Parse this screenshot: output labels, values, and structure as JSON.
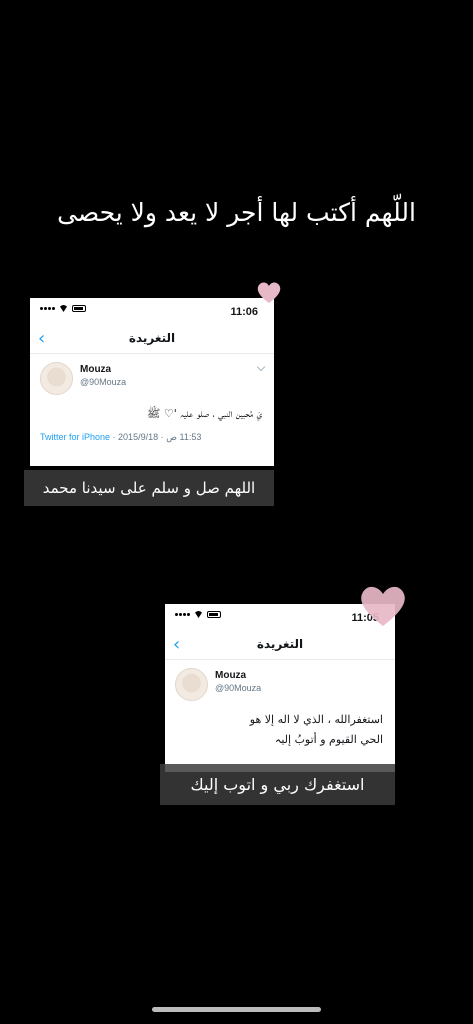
{
  "title": "اللّهم أكتب لها أجر لا يعد ولا يحصى",
  "tweets": [
    {
      "time": "11:06",
      "nav_title": "التغريدة",
      "back_icon": "chevron-left-icon",
      "name": "Mouza",
      "handle": "@90Mouza",
      "text": "يَ مُحبين النبي ، صلو عليہ '♡ ﷺ",
      "source": "Twitter for iPhone",
      "date": "2015/9/18",
      "clock": "11:53 ص",
      "caption": "اللهم صل و سلم على سيدنا محمد"
    },
    {
      "time": "11:05",
      "nav_title": "التغريدة",
      "back_icon": "chevron-left-icon",
      "name": "Mouza",
      "handle": "@90Mouza",
      "text_line1": "استغفرالله ، الذي لا اله إلا هو",
      "text_line2": "الحي القيوم و أتوبُ إليہ",
      "caption": "استغفرك ربي و اتوب إليك"
    }
  ],
  "colors": {
    "heart": "#e7b9c6",
    "link": "#1da1f2",
    "caption_bg": "#3c3c3c"
  }
}
